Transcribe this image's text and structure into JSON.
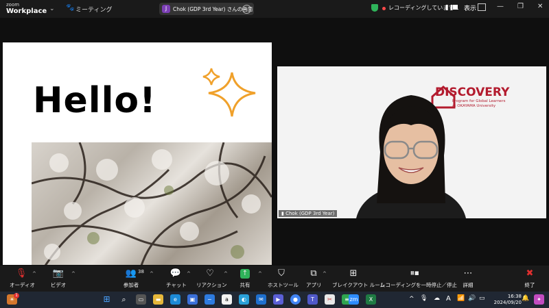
{
  "titlebar": {
    "logo_top": "zoom",
    "logo_bottom": "Workplace",
    "meeting_label": "ミーティング",
    "share_avatar": "J",
    "share_label": "Chok (GDP 3rd Year) さんの画面",
    "recording_label": "レコーディングしています...",
    "view_label": "表示",
    "minimize": "—",
    "restore": "❐",
    "close": "✕"
  },
  "slide": {
    "heading": "Hello!"
  },
  "camera": {
    "org_logo": "DISCOVERY",
    "org_sub1": "Program for Global Learners",
    "org_sub2": "at OKAYAMA University",
    "participant_name": "Chok (GDP 3rd Year)"
  },
  "toolbar": {
    "audio": "オーディオ",
    "video": "ビデオ",
    "participants": "参加者",
    "participants_count": "38",
    "chat": "チャット",
    "reactions": "リアクション",
    "share": "共有",
    "host_tools": "ホストツール",
    "apps": "アプリ",
    "breakout": "ブレイクアウト ルーム",
    "pause_recording": "レコーディングを一時停止／停止",
    "more": "詳細",
    "end": "終了"
  },
  "taskbar": {
    "notif_count": "1",
    "time": "16:38",
    "date": "2024/09/20",
    "ime": "A"
  },
  "colors": {
    "accent_green": "#2fb35a",
    "end_red": "#e02f2f",
    "brand_red": "#b31b2e"
  }
}
